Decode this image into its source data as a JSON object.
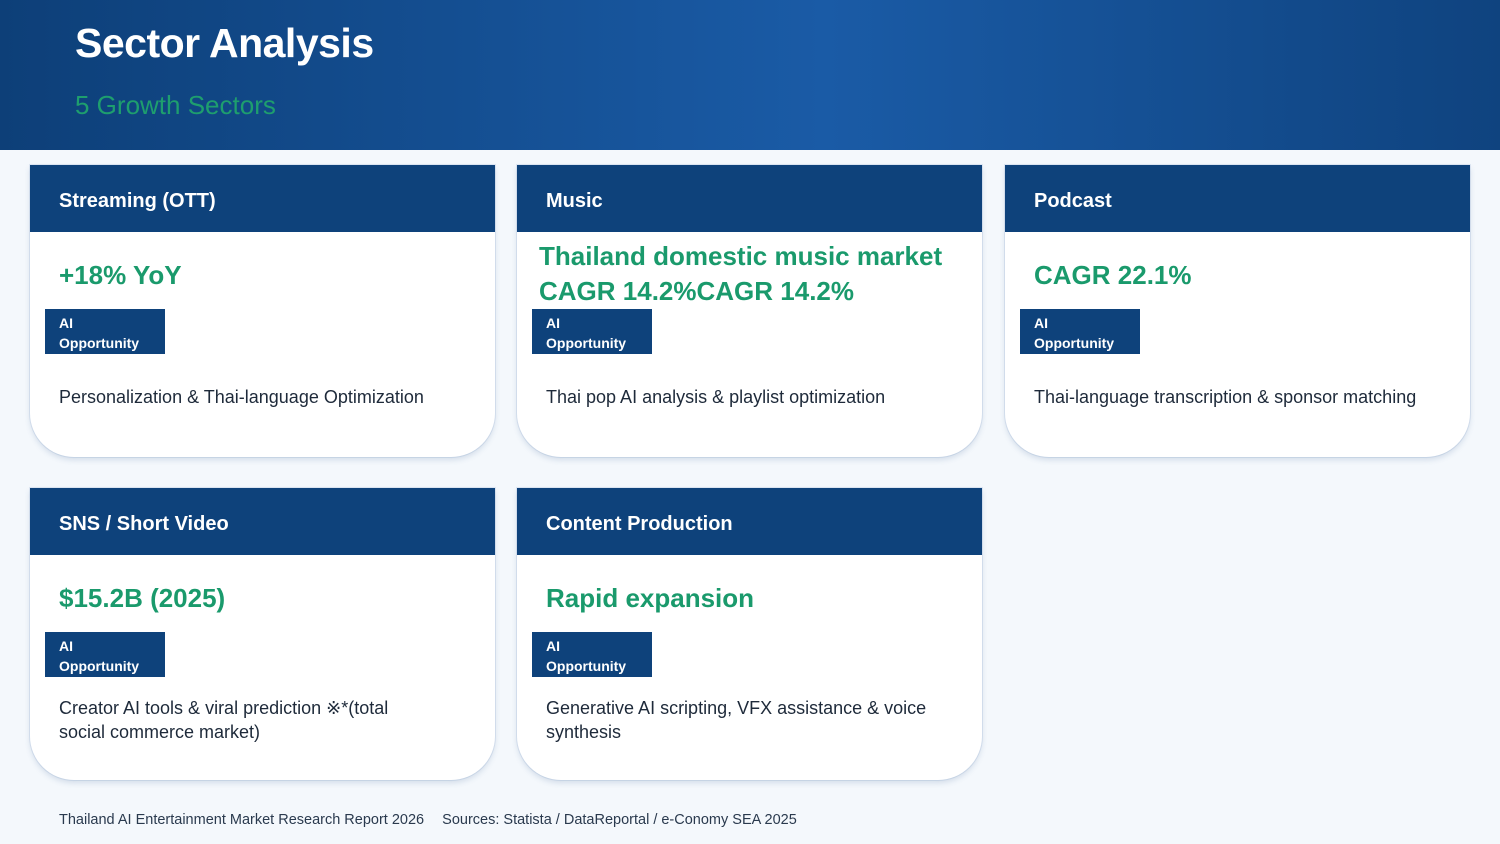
{
  "header": {
    "title": "Sector Analysis",
    "subtitle": "5 Growth Sectors"
  },
  "badge_label": "AI\nOpportunity",
  "cards": [
    {
      "title": "Streaming (OTT)",
      "metric": "+18% YoY",
      "badge": "AI Opportunity",
      "description": "Personalization & Thai-language Optimization"
    },
    {
      "title": "Music",
      "metric": "Thailand domestic music market CAGR 14.2%CAGR 14.2%",
      "badge": "AI Opportunity",
      "description": "Thai pop AI analysis & playlist optimization"
    },
    {
      "title": "Podcast",
      "metric": "CAGR 22.1%",
      "badge": "AI Opportunity",
      "description": "Thai-language transcription & sponsor matching"
    },
    {
      "title": "SNS / Short Video",
      "metric": "$15.2B (2025)",
      "badge": "AI Opportunity",
      "description": "Creator AI tools & viral prediction ※*(total social commerce market)"
    },
    {
      "title": "Content Production",
      "metric": "Rapid expansion",
      "badge": "AI Opportunity",
      "description": "Generative AI scripting, VFX assistance & voice synthesis"
    }
  ],
  "footer": {
    "report": "Thailand AI Entertainment Market Research Report 2026",
    "sources": "Sources: Statista / DataReportal / e-Conomy SEA 2025"
  },
  "colors": {
    "header_dark": "#0d3f78",
    "header_light": "#1a5ba6",
    "card_header": "#0e427b",
    "accent_green": "#1a9a6c",
    "background": "#f4f8fc"
  }
}
